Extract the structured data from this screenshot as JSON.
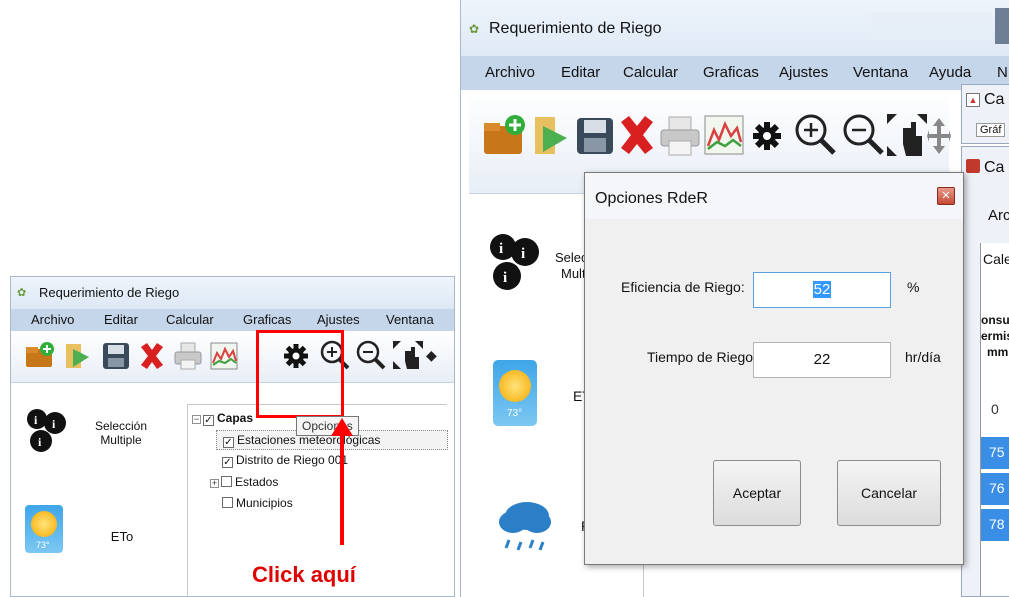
{
  "small_window": {
    "title": "Requerimiento de Riego",
    "menu": [
      "Archivo",
      "Editar",
      "Calcular",
      "Graficas",
      "Ajustes",
      "Ventana"
    ],
    "left_items": [
      {
        "label_line1": "Selección",
        "label_line2": "Multiple",
        "icon": "multi-select-icon"
      },
      {
        "label_line1": "ETo",
        "icon": "sun-weather-icon",
        "temp": "73°"
      }
    ],
    "tree": {
      "root": "Capas",
      "items": [
        "Estaciones meteorológicas",
        "Distrito de Riego 001",
        "Estados",
        "Municipios"
      ]
    },
    "tooltip": "Opciones",
    "annotation": "Click aquí"
  },
  "big_window": {
    "title": "Requerimiento de Riego",
    "menu": [
      "Archivo",
      "Editar",
      "Calcular",
      "Graficas",
      "Ajustes",
      "Ventana",
      "Ayuda",
      "N"
    ],
    "left_items": [
      {
        "label_line1": "Selec",
        "label_line2": "Mult",
        "icon": "multi-select-icon"
      },
      {
        "label_line1": "ET",
        "icon": "sun-weather-icon",
        "temp": "73°"
      },
      {
        "label_line1": "P",
        "icon": "rain-cloud-icon"
      }
    ],
    "right_fragments": {
      "win1_title": "Ca",
      "win1_sub": "Gráf",
      "win2_title": "Ca",
      "win2_menu": "Arc",
      "win2_tab": "Cale",
      "col_header": [
        "onsu",
        "ermis",
        "mm"
      ],
      "cells": [
        "0",
        "75",
        "76",
        "78"
      ]
    }
  },
  "dialog": {
    "title": "Opciones RdeR",
    "close_glyph": "✕",
    "fields": [
      {
        "label": "Eficiencia de Riego:",
        "value": "52",
        "unit": "%"
      },
      {
        "label": "Tiempo de Riego:",
        "value": "22",
        "unit": "hr/día"
      }
    ],
    "accept_label": "Aceptar",
    "cancel_label": "Cancelar"
  },
  "colors": {
    "menubar": "#c5d5ea",
    "accent_red": "#ff0000",
    "selection_blue": "#3399ff",
    "table_blue": "#3a8ee6"
  }
}
